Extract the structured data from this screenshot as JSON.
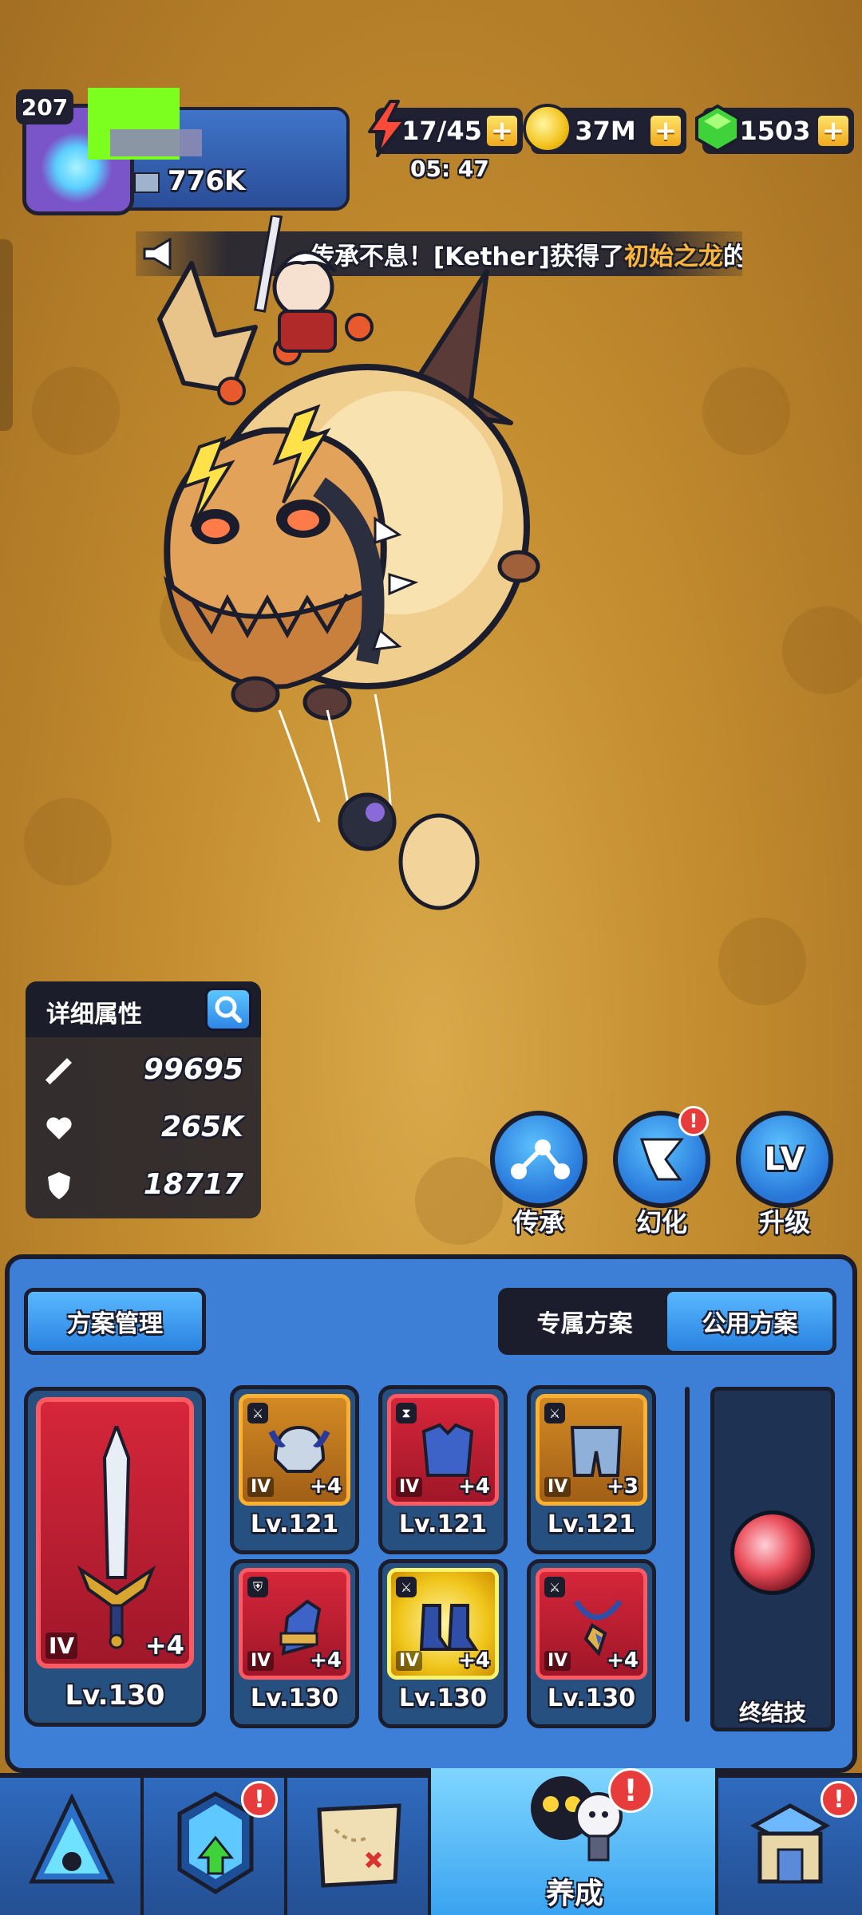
{
  "hud": {
    "player_level": "207",
    "power": "776K",
    "energy": "17/45",
    "energy_timer": "05: 47",
    "coins": "37M",
    "gems": "1503",
    "plus": "+"
  },
  "broadcast": {
    "prefix": "传承不息！[Kether]获得了",
    "highlight": "初始之龙",
    "suffix": "的:"
  },
  "stats": {
    "title": "详细属性",
    "attack": "99695",
    "health": "265K",
    "defense": "18717"
  },
  "actions": [
    {
      "label": "传承",
      "icon": "inherit-icon"
    },
    {
      "label": "幻化",
      "icon": "transform-icon",
      "badge": "!"
    },
    {
      "label": "升级",
      "icon": "levelup-icon",
      "icon_text": "LV"
    }
  ],
  "panel": {
    "plan_manage": "方案管理",
    "tabs": [
      "专属方案",
      "公用方案"
    ],
    "active_tab": 1,
    "weapon": {
      "tier": "IV",
      "plus": "+4",
      "level": "Lv.130"
    },
    "slots": [
      {
        "name": "helmet",
        "tier": "IV",
        "plus": "+4",
        "level": "Lv.121",
        "rarity": "orange",
        "mini": "sword"
      },
      {
        "name": "chest-armor",
        "tier": "IV",
        "plus": "+4",
        "level": "Lv.121",
        "rarity": "red",
        "mini": "hourglass"
      },
      {
        "name": "leg-armor",
        "tier": "IV",
        "plus": "+3",
        "level": "Lv.121",
        "rarity": "orange",
        "mini": "sword"
      },
      {
        "name": "gauntlet",
        "tier": "IV",
        "plus": "+4",
        "level": "Lv.130",
        "rarity": "red",
        "mini": "shield"
      },
      {
        "name": "boots",
        "tier": "IV",
        "plus": "+4",
        "level": "Lv.130",
        "rarity": "gold",
        "mini": "sword"
      },
      {
        "name": "necklace",
        "tier": "IV",
        "plus": "+4",
        "level": "Lv.130",
        "rarity": "red",
        "mini": "sword"
      }
    ],
    "ultimate_label": "终结技"
  },
  "nav": [
    {
      "name": "nav-battle",
      "label": ""
    },
    {
      "name": "nav-upgrade",
      "label": "",
      "badge": "!"
    },
    {
      "name": "nav-map",
      "label": ""
    },
    {
      "name": "nav-develop",
      "label": "养成",
      "badge": "!"
    },
    {
      "name": "nav-shop",
      "label": "",
      "badge": "!"
    }
  ],
  "colors": {
    "accent_blue": "#3d7fd6",
    "dark": "#1b1d2c",
    "highlight": "#ffb43a",
    "alert": "#e83b3b"
  }
}
